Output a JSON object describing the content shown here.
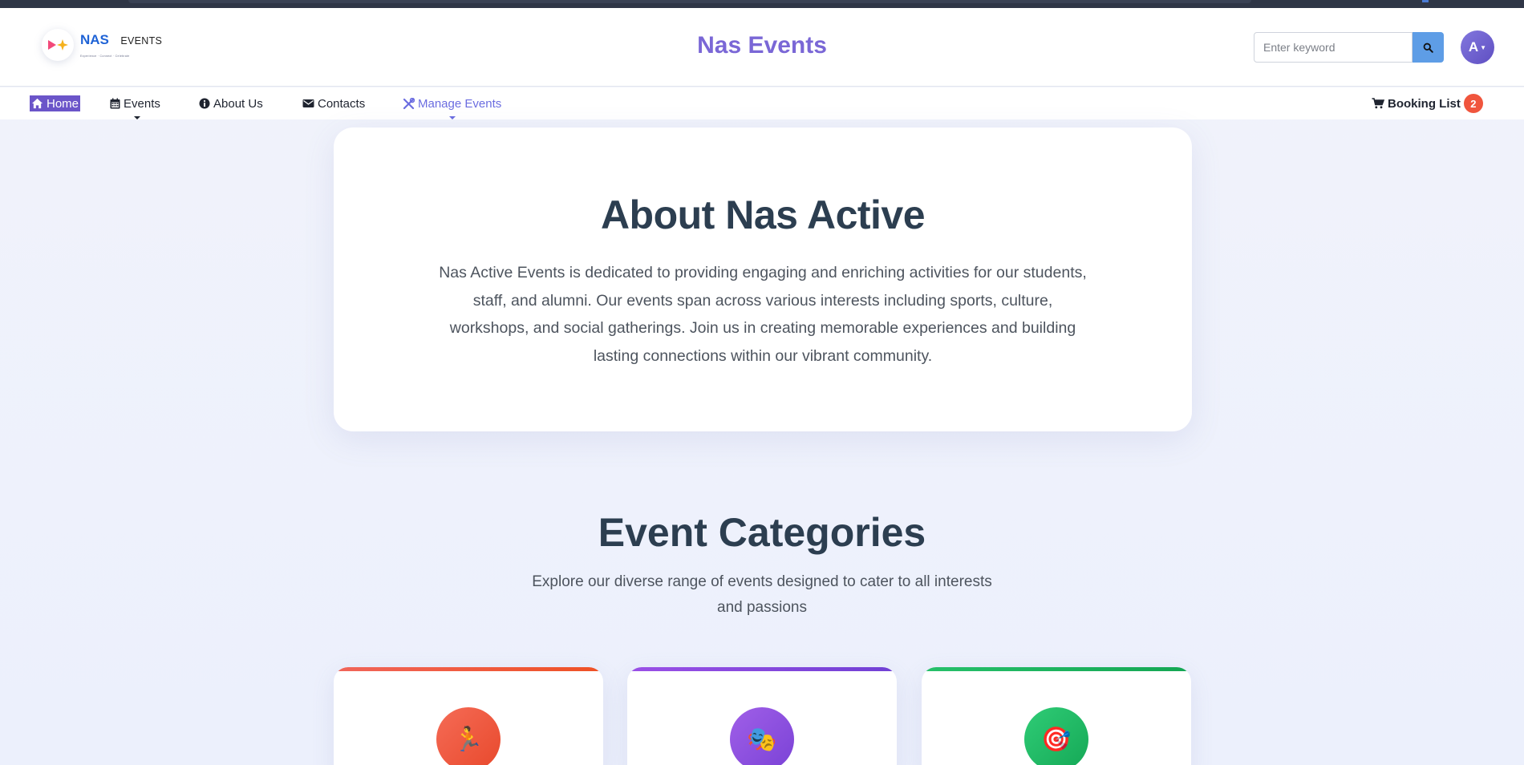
{
  "header": {
    "logo": {
      "brand": "NAS",
      "suffix": "EVENTS",
      "tagline": "Experience · Connect · Celebrate"
    },
    "title": "Nas Events",
    "search": {
      "placeholder": "Enter keyword",
      "value": ""
    },
    "avatar": {
      "initial": "A"
    }
  },
  "nav": {
    "items": [
      {
        "label": "Home",
        "icon": "home-icon",
        "active": true
      },
      {
        "label": "Events",
        "icon": "calendar-icon",
        "dropdown": true
      },
      {
        "label": "About Us",
        "icon": "info-icon"
      },
      {
        "label": "Contacts",
        "icon": "envelope-icon"
      },
      {
        "label": "Manage Events",
        "icon": "tools-icon",
        "dropdown": true
      }
    ],
    "booking": {
      "label": "Booking List",
      "icon": "cart-icon",
      "count": "2"
    }
  },
  "about": {
    "title": "About Nas Active",
    "text": "Nas Active Events is dedicated to providing engaging and enriching activities for our students, staff, and alumni. Our events span across various interests including sports, culture, workshops, and social gatherings. Join us in creating memorable experiences and building lasting connections within our vibrant community."
  },
  "categories": {
    "title": "Event Categories",
    "subtitle": "Explore our diverse range of events designed to cater to all interests and passions",
    "cards": [
      {
        "icon": "runner-icon",
        "emoji": "🏃",
        "accent": "#ef5125"
      },
      {
        "icon": "theater-masks-icon",
        "emoji": "🎭",
        "accent": "#7a42d6"
      },
      {
        "icon": "target-icon",
        "emoji": "🎯",
        "accent": "#15a856"
      }
    ]
  },
  "colors": {
    "brand_purple": "#7a67d6",
    "brand_blue": "#1f63d6",
    "search_button": "#5e9de6",
    "badge": "#f0553d",
    "heading": "#2c3e50"
  }
}
